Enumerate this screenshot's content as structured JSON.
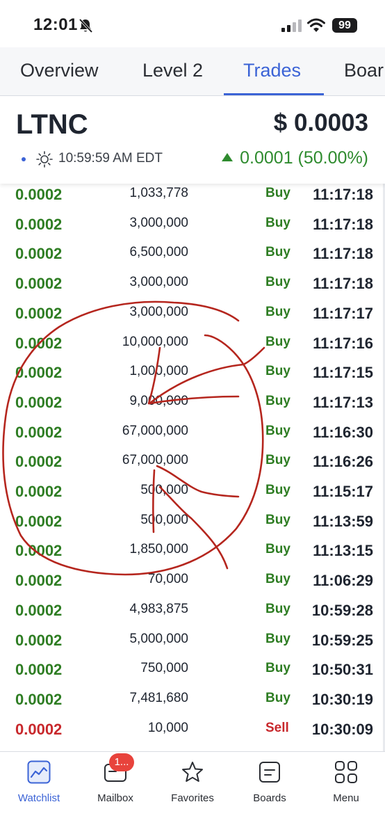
{
  "status_bar": {
    "time": "12:01",
    "battery": "99"
  },
  "tabs": [
    {
      "label": "Overview",
      "active": false
    },
    {
      "label": "Level 2",
      "active": false
    },
    {
      "label": "Trades",
      "active": true
    },
    {
      "label": "Boar",
      "active": false
    }
  ],
  "quote": {
    "symbol": "LTNC",
    "price": "$ 0.0003",
    "time": "10:59:59 AM EDT",
    "change": "0.0001 (50.00%)"
  },
  "trades": [
    {
      "price": "0.0002",
      "size": "1,033,778",
      "side": "Buy",
      "time": "11:17:18"
    },
    {
      "price": "0.0002",
      "size": "3,000,000",
      "side": "Buy",
      "time": "11:17:18"
    },
    {
      "price": "0.0002",
      "size": "6,500,000",
      "side": "Buy",
      "time": "11:17:18"
    },
    {
      "price": "0.0002",
      "size": "3,000,000",
      "side": "Buy",
      "time": "11:17:18"
    },
    {
      "price": "0.0002",
      "size": "3,000,000",
      "side": "Buy",
      "time": "11:17:17"
    },
    {
      "price": "0.0002",
      "size": "10,000,000",
      "side": "Buy",
      "time": "11:17:16"
    },
    {
      "price": "0.0002",
      "size": "1,000,000",
      "side": "Buy",
      "time": "11:17:15"
    },
    {
      "price": "0.0002",
      "size": "9,000,000",
      "side": "Buy",
      "time": "11:17:13"
    },
    {
      "price": "0.0002",
      "size": "67,000,000",
      "side": "Buy",
      "time": "11:16:30"
    },
    {
      "price": "0.0002",
      "size": "67,000,000",
      "side": "Buy",
      "time": "11:16:26"
    },
    {
      "price": "0.0002",
      "size": "500,000",
      "side": "Buy",
      "time": "11:15:17"
    },
    {
      "price": "0.0002",
      "size": "500,000",
      "side": "Buy",
      "time": "11:13:59"
    },
    {
      "price": "0.0002",
      "size": "1,850,000",
      "side": "Buy",
      "time": "11:13:15"
    },
    {
      "price": "0.0002",
      "size": "70,000",
      "side": "Buy",
      "time": "11:06:29"
    },
    {
      "price": "0.0002",
      "size": "4,983,875",
      "side": "Buy",
      "time": "10:59:28"
    },
    {
      "price": "0.0002",
      "size": "5,000,000",
      "side": "Buy",
      "time": "10:59:25"
    },
    {
      "price": "0.0002",
      "size": "750,000",
      "side": "Buy",
      "time": "10:50:31"
    },
    {
      "price": "0.0002",
      "size": "7,481,680",
      "side": "Buy",
      "time": "10:30:19"
    },
    {
      "price": "0.0002",
      "size": "10,000",
      "side": "Sell",
      "time": "10:30:09"
    }
  ],
  "bottom_nav": {
    "badge": "1...",
    "items": [
      {
        "label": "Watchlist",
        "icon": "chart-line-icon",
        "active": true
      },
      {
        "label": "Mailbox",
        "icon": "mailbox-icon",
        "active": false
      },
      {
        "label": "Favorites",
        "icon": "star-icon",
        "active": false
      },
      {
        "label": "Boards",
        "icon": "boards-icon",
        "active": false
      },
      {
        "label": "Menu",
        "icon": "grid-icon",
        "active": false
      }
    ]
  },
  "colors": {
    "accent": "#3b63d6",
    "buy": "#2e7d23",
    "sell": "#c8282c",
    "annotation": "#b5261e"
  }
}
